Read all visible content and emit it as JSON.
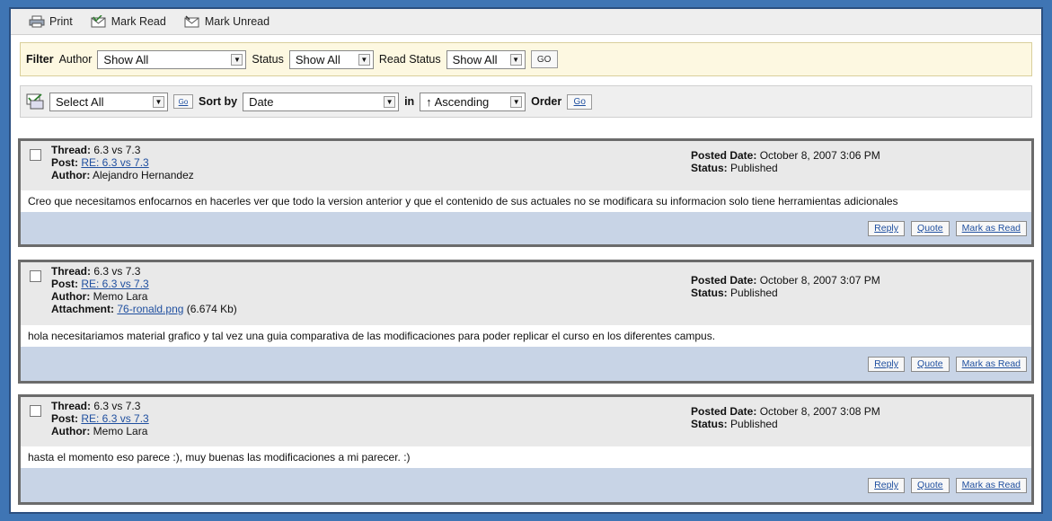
{
  "toolbar": {
    "print": "Print",
    "mark_read": "Mark Read",
    "mark_unread": "Mark Unread"
  },
  "filter": {
    "label": "Filter",
    "author_label": "Author",
    "author_value": "Show All",
    "status_label": "Status",
    "status_value": "Show All",
    "read_status_label": "Read Status",
    "read_status_value": "Show All",
    "go": "GO"
  },
  "sort": {
    "select_value": "Select All",
    "go1": "Go",
    "sortby_label": "Sort by",
    "sortby_value": "Date",
    "in_label": "in",
    "order_value": "↑ Ascending",
    "order_label": "Order",
    "go2": "Go"
  },
  "labels": {
    "thread": "Thread:",
    "post": "Post:",
    "author": "Author:",
    "attachment": "Attachment:",
    "posted_date": "Posted Date:",
    "status": "Status:",
    "reply": "Reply",
    "quote": "Quote",
    "mark_as_read": "Mark as Read"
  },
  "posts": [
    {
      "thread": "6.3 vs 7.3",
      "post": "RE: 6.3 vs 7.3",
      "author": "Alejandro Hernandez",
      "posted_date": "October 8, 2007 3:06 PM",
      "status": "Published",
      "body": "Creo que necesitamos enfocarnos en hacerles ver que todo la version anterior y que el contenido de sus actuales no se modificara su informacion solo tiene herramientas adicionales"
    },
    {
      "thread": "6.3 vs 7.3",
      "post": "RE: 6.3 vs 7.3",
      "author": "Memo Lara",
      "attachment": "76-ronald.png",
      "attachment_size": "(6.674 Kb)",
      "posted_date": "October 8, 2007 3:07 PM",
      "status": "Published",
      "body": "hola necesitariamos material grafico y tal vez una guia comparativa de las modificaciones para poder replicar el curso en los diferentes campus."
    },
    {
      "thread": "6.3 vs 7.3",
      "post": "RE: 6.3 vs 7.3",
      "author": "Memo Lara",
      "posted_date": "October 8, 2007 3:08 PM",
      "status": "Published",
      "body": "hasta el momento eso parece :), muy buenas las modificaciones a mi parecer. :)"
    }
  ],
  "colors": {
    "frame": "#3f75b4",
    "filter_bg": "#fdf8e1",
    "post_foot": "#c8d4e6",
    "link": "#1f4f9f"
  }
}
